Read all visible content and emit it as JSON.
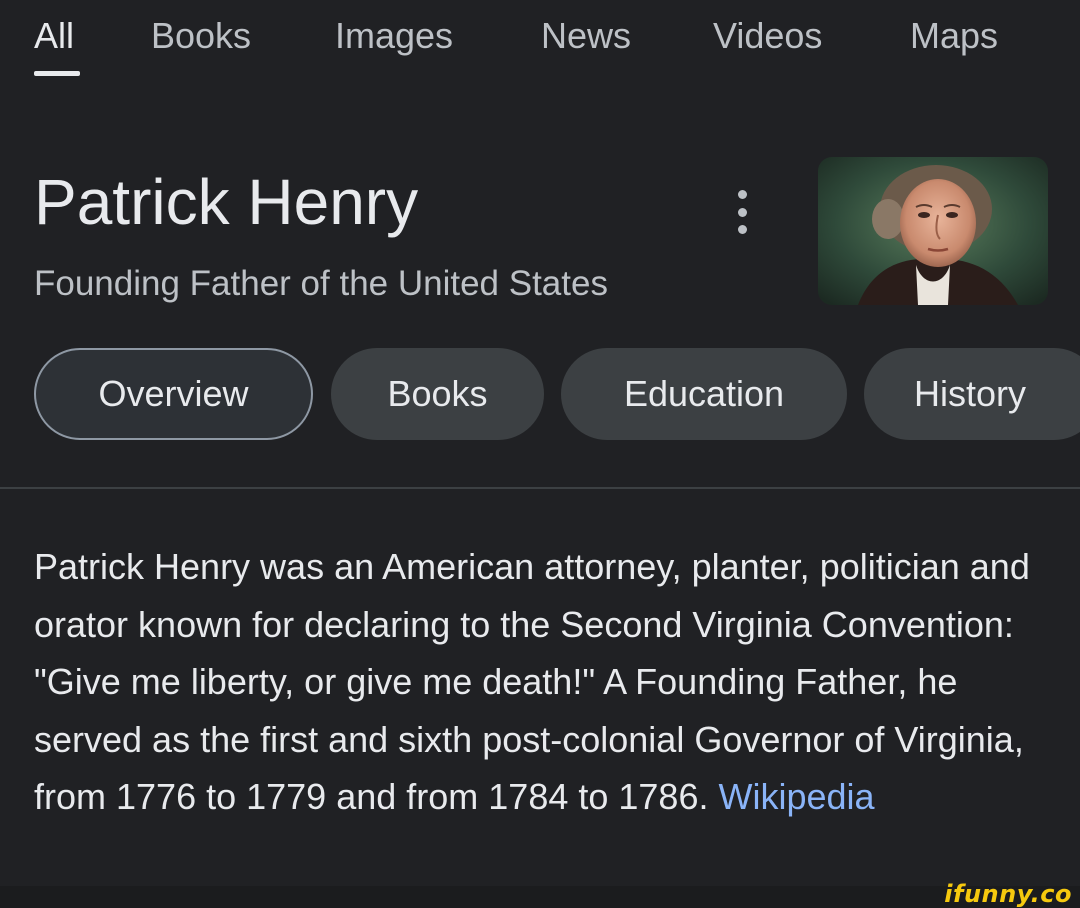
{
  "nav": {
    "tabs": [
      {
        "label": "All",
        "active": true
      },
      {
        "label": "Books"
      },
      {
        "label": "Images"
      },
      {
        "label": "News"
      },
      {
        "label": "Videos"
      },
      {
        "label": "Maps"
      }
    ]
  },
  "entity": {
    "title": "Patrick Henry",
    "subtitle": "Founding Father of the United States",
    "menu_icon": "more-vert-icon",
    "image": "portrait of Patrick Henry"
  },
  "chips": [
    {
      "label": "Overview",
      "selected": true
    },
    {
      "label": "Books"
    },
    {
      "label": "Education"
    },
    {
      "label": "History"
    }
  ],
  "description": {
    "text": "Patrick Henry was an American attorney, planter, politician and orator known for declaring to the Second Virginia Convention: \"Give me liberty, or give me death!\" A Founding Father, he served as the first and sixth post-colonial Governor of Virginia, from 1776 to 1779 and from 1784 to 1786.",
    "source_link": "Wikipedia"
  },
  "watermark": "ifunny.co",
  "colors": {
    "background": "#202124",
    "chip": "#3c4043",
    "link": "#8ab4f8",
    "watermark": "#f6c90e"
  }
}
